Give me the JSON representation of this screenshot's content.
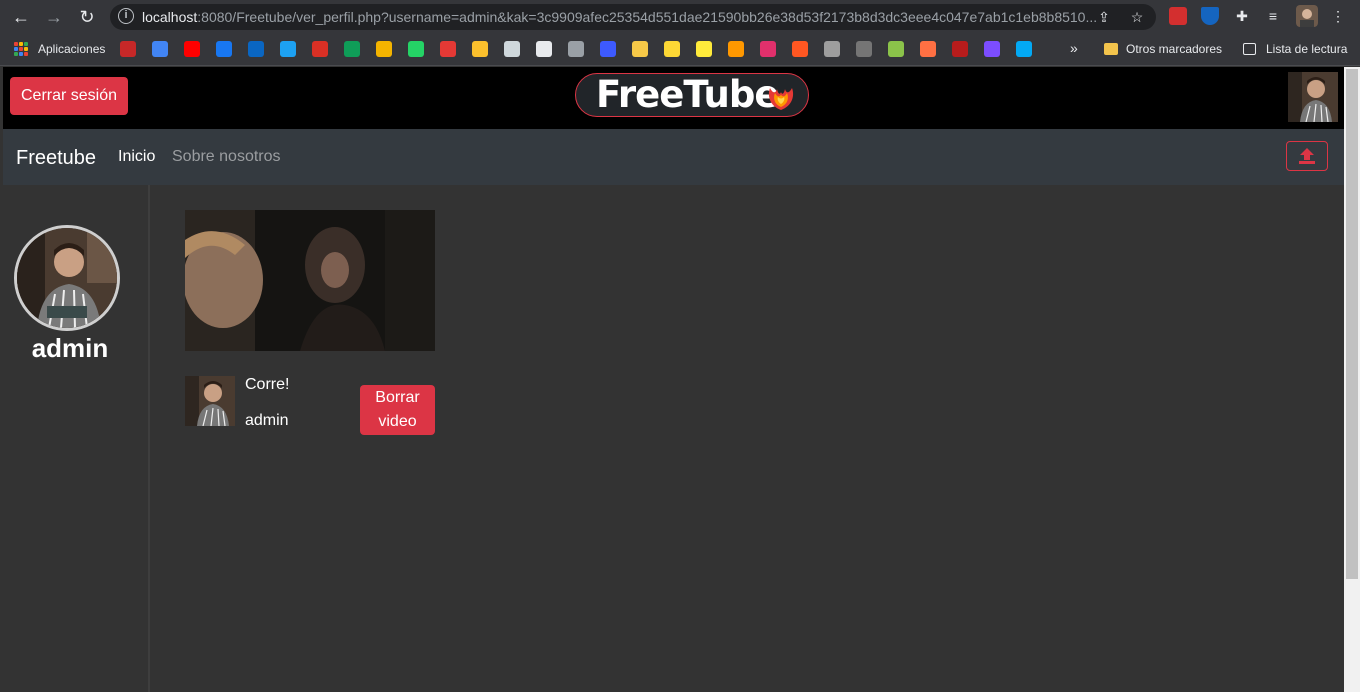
{
  "browser": {
    "url_host": "localhost",
    "url_rest": ":8080/Freetube/ver_perfil.php?username=admin&kak=3c9909afec25354d551dae21590bb26e38d53f2173b8d3dc3eee4c047e7ab1c1eb8b8510...",
    "bookmarks": {
      "apps_label": "Aplicaciones",
      "other_label": "Otros marcadores",
      "reading_list_label": "Lista de lectura",
      "favicon_colors": [
        "#c62828",
        "#4285f4",
        "#ff0000",
        "#1877f2",
        "#0a66c2",
        "#1da1f2",
        "#d93025",
        "#0f9d58",
        "#f4b400",
        "#25d366",
        "#e53935",
        "#fbc02d",
        "#cfd8dc",
        "#e8eaed",
        "#9aa0a6",
        "#3d5afe",
        "#f7c948",
        "#fdd835",
        "#ffeb3b",
        "#ff9800",
        "#e1306c",
        "#ff5722",
        "#9e9e9e",
        "#757575",
        "#8bc34a",
        "#ff7043",
        "#b71c1c",
        "#7c4dff",
        "#03a9f4"
      ]
    }
  },
  "header": {
    "logout_label": "Cerrar sesión",
    "brand": "FreeTube"
  },
  "navbar": {
    "brand": "Freetube",
    "links": [
      "Inicio",
      "Sobre nosotros"
    ]
  },
  "profile": {
    "username": "admin"
  },
  "videos": [
    {
      "title": "Corre!",
      "owner": "admin",
      "delete_label_1": "Borrar",
      "delete_label_2": "video"
    }
  ],
  "colors": {
    "accent": "#dc3545",
    "navbar": "#343a40",
    "page_bg": "#333333"
  }
}
